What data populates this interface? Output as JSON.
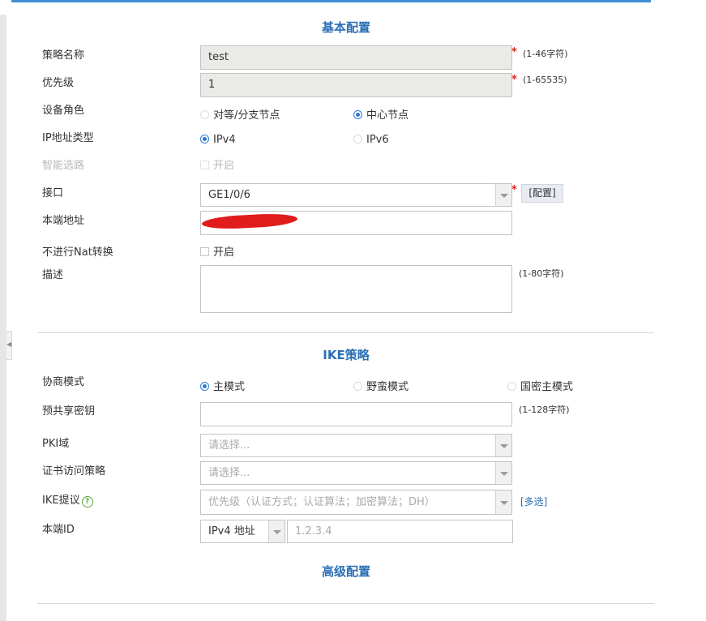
{
  "sections": {
    "basic": "基本配置",
    "ike": "IKE策略",
    "advanced": "高级配置"
  },
  "basic": {
    "policy_name": {
      "label": "策略名称",
      "value": "test",
      "hint": "(1-46字符)"
    },
    "priority": {
      "label": "优先级",
      "value": "1",
      "hint": "(1-65535)"
    },
    "device_role": {
      "label": "设备角色",
      "options": [
        "对等/分支节点",
        "中心节点"
      ],
      "selected": "中心节点"
    },
    "ip_type": {
      "label": "IP地址类型",
      "options": [
        "IPv4",
        "IPv6"
      ],
      "selected": "IPv4"
    },
    "smart_route": {
      "label": "智能选路",
      "checkbox_label": "开启",
      "checked": false,
      "disabled": true
    },
    "interface": {
      "label": "接口",
      "value": "GE1/0/6",
      "config_button": "[配置]"
    },
    "local_address": {
      "label": "本端地址",
      "value": ""
    },
    "no_nat": {
      "label": "不进行Nat转换",
      "checkbox_label": "开启",
      "checked": false
    },
    "description": {
      "label": "描述",
      "value": "",
      "hint": "(1-80字符)"
    },
    "required_mark": "*"
  },
  "ike": {
    "negotiation_mode": {
      "label": "协商模式",
      "options": [
        "主模式",
        "野蛮模式",
        "国密主模式"
      ],
      "selected": "主模式"
    },
    "psk": {
      "label": "预共享密钥",
      "value": "",
      "hint": "(1-128字符)"
    },
    "pki_domain": {
      "label": "PKI域",
      "placeholder": "请选择..."
    },
    "cert_policy": {
      "label": "证书访问策略",
      "placeholder": "请选择..."
    },
    "ike_proposal": {
      "label": "IKE提议",
      "help_icon": "?",
      "placeholder": "优先级（认证方式；认证算法；加密算法；DH）",
      "multi_link": "[多选]"
    },
    "local_id": {
      "label": "本端ID",
      "type": "IPv4 地址",
      "placeholder": "1.2.3.4"
    }
  },
  "colors": {
    "accent": "#2a6fb5",
    "required": "#e02020",
    "radio": "#2a7bd4"
  },
  "icons": {
    "help": "help-circle-icon",
    "dropdown": "chevron-down-icon",
    "collapse": "collapse-left-icon"
  }
}
